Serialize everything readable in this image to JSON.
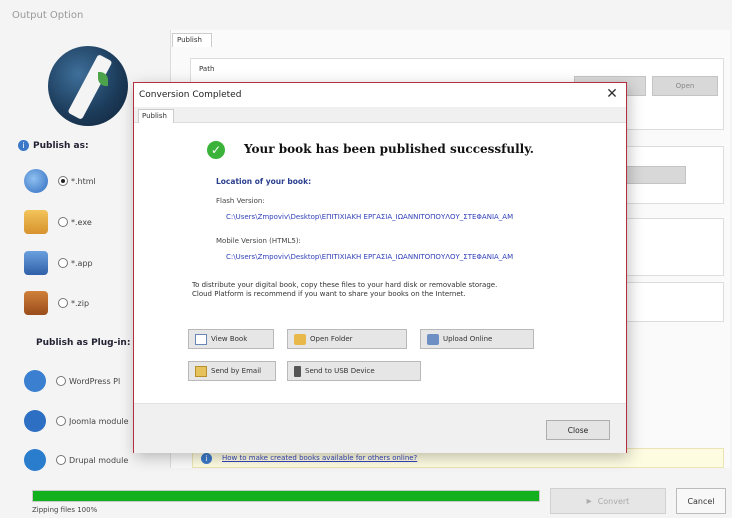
{
  "window": {
    "title": "Output Option"
  },
  "left_panel": {
    "publish_as_label": "Publish as:",
    "formats": [
      {
        "label": "*.html",
        "selected": true,
        "icon": "html-globe-icon",
        "color": "#3a78c8"
      },
      {
        "label": "*.exe",
        "selected": false,
        "icon": "exe-box-icon",
        "color": "#e0a43a"
      },
      {
        "label": "*.app",
        "selected": false,
        "icon": "app-mac-icon",
        "color": "#3d6fb5"
      },
      {
        "label": "*.zip",
        "selected": false,
        "icon": "zip-book-icon",
        "color": "#b0622a"
      }
    ],
    "plugin_label": "Publish as Plug-in:",
    "plugins": [
      {
        "label": "WordPress Pl",
        "icon": "wordpress-icon",
        "color": "#3a7fd0"
      },
      {
        "label": "Joomla module",
        "icon": "joomla-icon",
        "color": "#2d6fc2"
      },
      {
        "label": "Drupal module",
        "icon": "drupal-icon",
        "color": "#2a7ccc"
      }
    ]
  },
  "right_panel": {
    "tab_label": "Publish",
    "path_label": "Path",
    "open_button_label": "Open",
    "help_link": "How to make created books available for others online?"
  },
  "dialog": {
    "title": "Conversion Completed",
    "tab_label": "Publish",
    "success_message": "Your book has been published successfully.",
    "location_label": "Location of your book:",
    "flash_label": "Flash Version:",
    "flash_path": "C:\\Users\\Zmpoviv\\Desktop\\ΕΠΙΤΙΧΙΑΚΗ ΕΡΓΑΣΙΑ_ΙΩΑΝΝΙΤΟΠΟΥΛΟΥ_ΣΤΕΦΑΝΙΑ_ΑΜ",
    "mobile_label": "Mobile Version (HTML5):",
    "mobile_path": "C:\\Users\\Zmpoviv\\Desktop\\ΕΠΙΤΙΧΙΑΚΗ ΕΡΓΑΣΙΑ_ΙΩΑΝΝΙΤΟΠΟΥΛΟΥ_ΣΤΕΦΑΝΙΑ_ΑΜ",
    "note_line1": "To distribute your digital book, copy these files to your hard disk or removable storage.",
    "note_line2": "Cloud Platform is recommend if you want to share your books on the Internet.",
    "buttons": {
      "view_book": "View Book",
      "open_folder": "Open Folder",
      "upload_online": "Upload Online",
      "send_email": "Send by Email",
      "send_usb": "Send to USB Device"
    },
    "close_label": "Close"
  },
  "status": {
    "text": "Zipping files 100%",
    "progress": 1.0,
    "progress_color": "#12b01c"
  },
  "bottom_buttons": {
    "convert_label": "Convert",
    "cancel_label": "Cancel"
  }
}
